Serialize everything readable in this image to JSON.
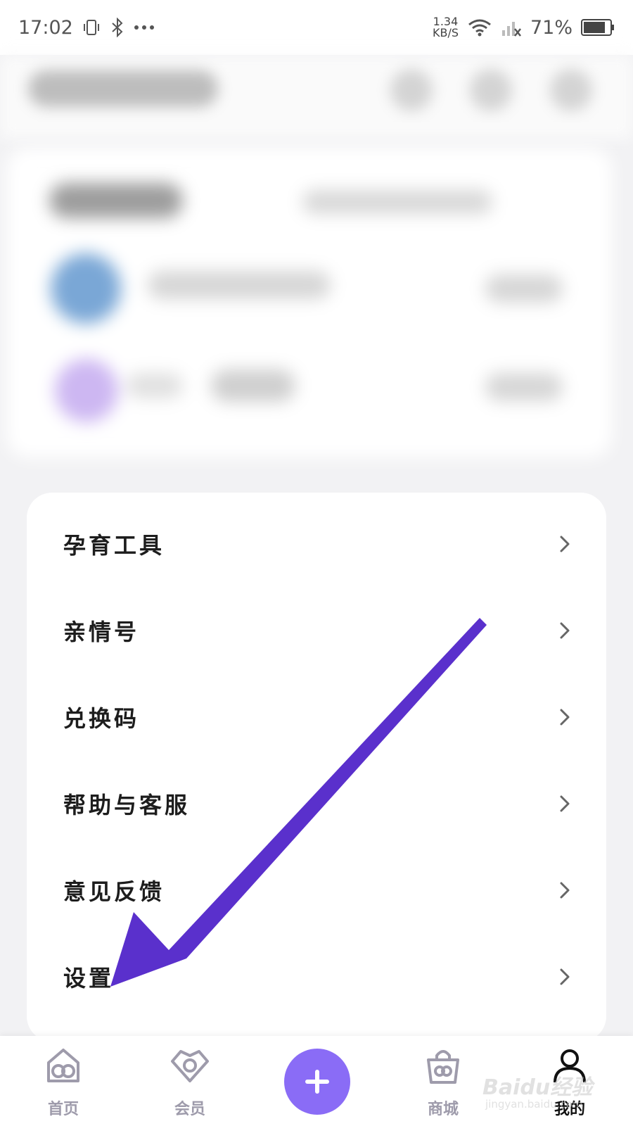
{
  "status_bar": {
    "time": "17:02",
    "net_speed_value": "1.34",
    "net_speed_unit": "KB/S",
    "battery": "71%"
  },
  "menu": {
    "items": [
      {
        "label": "孕育工具"
      },
      {
        "label": "亲情号"
      },
      {
        "label": "兑换码"
      },
      {
        "label": "帮助与客服"
      },
      {
        "label": "意见反馈"
      },
      {
        "label": "设置"
      }
    ]
  },
  "bottom_nav": {
    "home": "首页",
    "member": "会员",
    "mall": "商城",
    "mine": "我的"
  },
  "watermark": {
    "brand": "Baidu经验",
    "url": "jingyan.baidu.com"
  },
  "colors": {
    "accent": "#8a6cf6",
    "annotation_arrow": "#5a30cc",
    "nav_inactive": "#9e9bab"
  }
}
